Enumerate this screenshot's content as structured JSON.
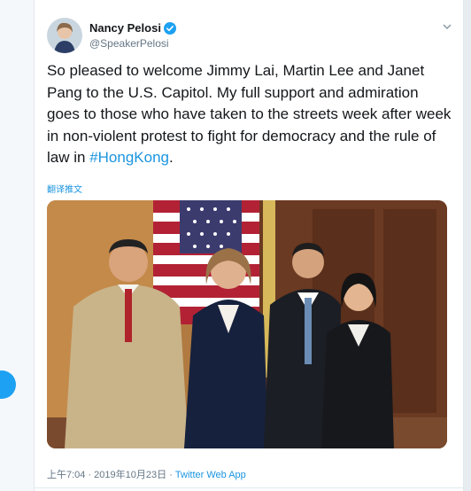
{
  "tweet": {
    "author_name": "Nancy Pelosi",
    "author_handle": "@SpeakerPelosi",
    "text_before": "So pleased to welcome Jimmy Lai, Martin Lee and Janet Pang to the U.S. Capitol. My full support and admiration goes to those who have taken to the streets week after week in non-violent protest to fight for democracy and the rule of law in ",
    "hashtag": "#HongKong",
    "text_after": ".",
    "translate_label": "翻译推文",
    "time": "上午7:04 · 2019年10月23日 · ",
    "source": "Twitter Web App"
  },
  "icons": {
    "verified": "verified-badge-icon",
    "chevron": "chevron-down-icon"
  },
  "colors": {
    "link": "#1b95e0",
    "verified": "#1da1f2",
    "text": "#14171a",
    "secondary": "#657786"
  }
}
